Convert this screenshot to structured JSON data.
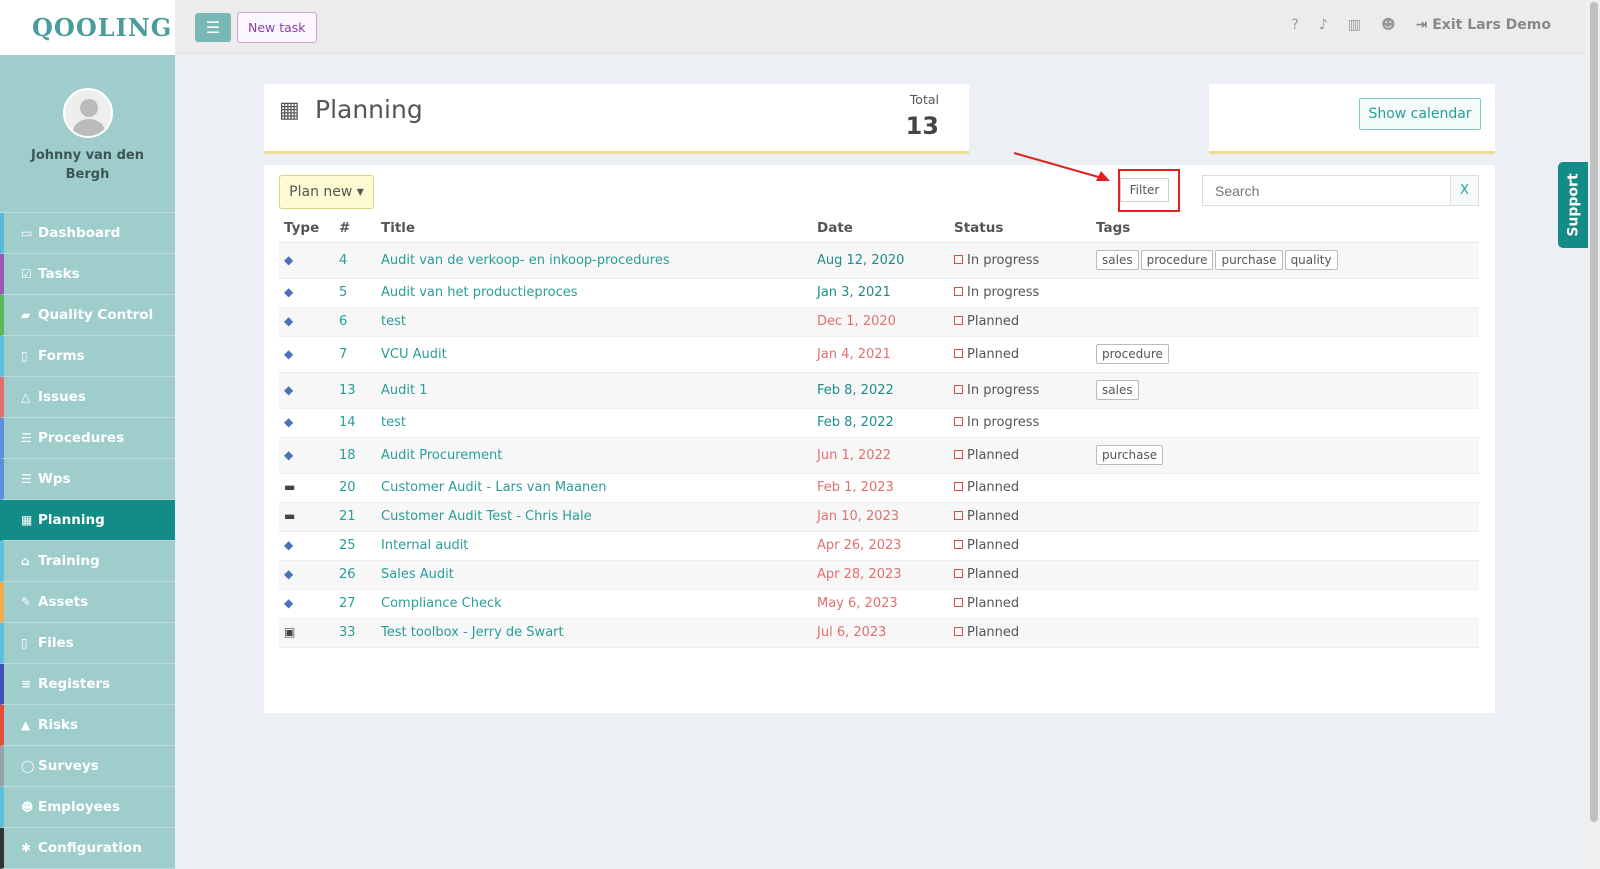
{
  "app": {
    "logo": "QOOLING"
  },
  "user": {
    "name": "Johnny van den Bergh"
  },
  "sidebar": {
    "items": [
      {
        "label": "Dashboard",
        "icon": "monitor-icon",
        "glyph": "▭",
        "accent": "#5bb8d8"
      },
      {
        "label": "Tasks",
        "icon": "check-icon",
        "glyph": "☑",
        "accent": "#9b59b6"
      },
      {
        "label": "Quality Control",
        "icon": "book-icon",
        "glyph": "▰",
        "accent": "#5cb85c"
      },
      {
        "label": "Forms",
        "icon": "file-icon",
        "glyph": "▯",
        "accent": "#5bc0de"
      },
      {
        "label": "Issues",
        "icon": "bell-icon",
        "glyph": "△",
        "accent": "#e07070"
      },
      {
        "label": "Procedures",
        "icon": "list-icon",
        "glyph": "☰",
        "accent": "#5b8fd8"
      },
      {
        "label": "Wps",
        "icon": "layers-icon",
        "glyph": "☰",
        "accent": "#5b8fd8"
      },
      {
        "label": "Planning",
        "icon": "calendar-icon",
        "glyph": "▦",
        "accent": "#138b86",
        "active": true
      },
      {
        "label": "Training",
        "icon": "graduation-cap-icon",
        "glyph": "⌂",
        "accent": "#5bc0de"
      },
      {
        "label": "Assets",
        "icon": "wrench-icon",
        "glyph": "✎",
        "accent": "#f0ad4e"
      },
      {
        "label": "Files",
        "icon": "document-icon",
        "glyph": "▯",
        "accent": "#5bc0de"
      },
      {
        "label": "Registers",
        "icon": "bars-icon",
        "glyph": "≡",
        "accent": "#3f51b5"
      },
      {
        "label": "Risks",
        "icon": "warning-icon",
        "glyph": "▲",
        "accent": "#e74c3c"
      },
      {
        "label": "Surveys",
        "icon": "comment-icon",
        "glyph": "◯",
        "accent": "#95a5a6"
      },
      {
        "label": "Employees",
        "icon": "users-icon",
        "glyph": "☻",
        "accent": "#5bc0de"
      },
      {
        "label": "Configuration",
        "icon": "gear-icon",
        "glyph": "✱",
        "accent": "#333333"
      }
    ]
  },
  "topbar": {
    "new_task_label": "New task",
    "exit_label": "Exit Lars Demo",
    "icons": [
      "help-icon",
      "bell-icon",
      "building-icon",
      "user-icon"
    ]
  },
  "page": {
    "title": "Planning",
    "total_label": "Total",
    "total_value": "13",
    "show_calendar_label": "Show calendar"
  },
  "toolbar": {
    "plan_new_label": "Plan new ▾",
    "filter_label": "Filter",
    "search_placeholder": "Search",
    "clear_label": "X"
  },
  "table": {
    "headers": {
      "type": "Type",
      "num": "#",
      "title": "Title",
      "date": "Date",
      "status": "Status",
      "tags": "Tags"
    },
    "rows": [
      {
        "type_icon": "graduation-cap-icon",
        "num": "4",
        "title": "Audit van de verkoop- en inkoop-procedures",
        "date": "Aug 12, 2020",
        "date_color": "green",
        "status": "In progress",
        "tags": [
          "sales",
          "procedure",
          "purchase",
          "quality"
        ]
      },
      {
        "type_icon": "graduation-cap-icon",
        "num": "5",
        "title": "Audit van het productieproces",
        "date": "Jan 3, 2021",
        "date_color": "green",
        "status": "In progress",
        "tags": []
      },
      {
        "type_icon": "graduation-cap-icon",
        "num": "6",
        "title": "test",
        "date": "Dec 1, 2020",
        "date_color": "red",
        "status": "Planned",
        "tags": []
      },
      {
        "type_icon": "graduation-cap-icon",
        "num": "7",
        "title": "VCU Audit",
        "date": "Jan 4, 2021",
        "date_color": "red",
        "status": "Planned",
        "tags": [
          "procedure"
        ]
      },
      {
        "type_icon": "graduation-cap-icon",
        "num": "13",
        "title": "Audit 1",
        "date": "Feb 8, 2022",
        "date_color": "green",
        "status": "In progress",
        "tags": [
          "sales"
        ]
      },
      {
        "type_icon": "graduation-cap-icon",
        "num": "14",
        "title": "test",
        "date": "Feb 8, 2022",
        "date_color": "green",
        "status": "In progress",
        "tags": []
      },
      {
        "type_icon": "graduation-cap-icon",
        "num": "18",
        "title": "Audit Procurement",
        "date": "Jun 1, 2022",
        "date_color": "red",
        "status": "Planned",
        "tags": [
          "purchase"
        ]
      },
      {
        "type_icon": "coffee-icon",
        "num": "20",
        "title": "Customer Audit - Lars van Maanen",
        "date": "Feb 1, 2023",
        "date_color": "red",
        "status": "Planned",
        "tags": []
      },
      {
        "type_icon": "coffee-icon",
        "num": "21",
        "title": "Customer Audit Test - Chris Hale",
        "date": "Jan 10, 2023",
        "date_color": "red",
        "status": "Planned",
        "tags": []
      },
      {
        "type_icon": "graduation-cap-icon",
        "num": "25",
        "title": "Internal audit",
        "date": "Apr 26, 2023",
        "date_color": "red",
        "status": "Planned",
        "tags": []
      },
      {
        "type_icon": "graduation-cap-icon",
        "num": "26",
        "title": "Sales Audit",
        "date": "Apr 28, 2023",
        "date_color": "red",
        "status": "Planned",
        "tags": []
      },
      {
        "type_icon": "graduation-cap-icon",
        "num": "27",
        "title": "Compliance Check",
        "date": "May 6, 2023",
        "date_color": "red",
        "status": "Planned",
        "tags": []
      },
      {
        "type_icon": "briefcase-icon",
        "num": "33",
        "title": "Test toolbox - Jerry de Swart",
        "date": "Jul 6, 2023",
        "date_color": "red",
        "status": "Planned",
        "tags": []
      }
    ]
  },
  "support": {
    "label": "Support"
  },
  "colors": {
    "accent": "#138b86",
    "link": "#2a9d98",
    "overdue": "#e07070",
    "sidebar": "#9ecdcc"
  }
}
